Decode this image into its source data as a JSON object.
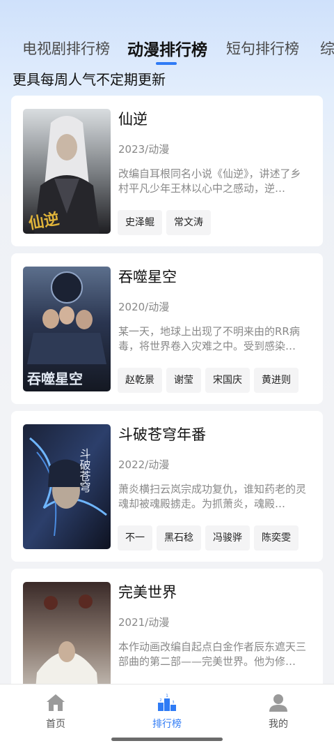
{
  "tabs": [
    {
      "label": "电视剧排行榜"
    },
    {
      "label": "动漫排行榜"
    },
    {
      "label": "短句排行榜"
    },
    {
      "label": "综"
    }
  ],
  "active_tab": "动漫排行榜",
  "subtitle": "更具每周人气不定期更新",
  "cards": [
    {
      "title": "仙逆",
      "meta": "2023/动漫",
      "desc": "改编自耳根同名小说《仙逆》，讲述了乡村平凡少年王林以心中之感动，逆…",
      "tags": [
        "史泽鲲",
        "常文涛"
      ],
      "poster_text": "仙逆"
    },
    {
      "title": "吞噬星空",
      "meta": "2020/动漫",
      "desc": "某一天，地球上出现了不明来由的RR病毒，将世界卷入灾难之中。受到感染…",
      "tags": [
        "赵乾景",
        "谢莹",
        "宋国庆",
        "黄进则"
      ],
      "poster_text": "吞噬星空"
    },
    {
      "title": "斗破苍穹年番",
      "meta": "2022/动漫",
      "desc": "萧炎横扫云岚宗成功复仇，谁知药老的灵魂却被魂殿掳走。为抓萧炎，魂殿…",
      "tags": [
        "不一",
        "黑石稔",
        "冯骏骅",
        "陈奕雯"
      ],
      "poster_text": "斗破苍穹"
    },
    {
      "title": "完美世界",
      "meta": "2021/动漫",
      "desc": "本作动画改编自起点白金作者辰东遮天三部曲的第二部——完美世界。他为修…",
      "tags": [],
      "poster_text": ""
    }
  ],
  "bottom_nav": [
    {
      "label": "首页",
      "icon": "home-icon"
    },
    {
      "label": "排行榜",
      "icon": "podium-icon"
    },
    {
      "label": "我的",
      "icon": "person-icon"
    }
  ],
  "colors": {
    "accent": "#2f7bf5",
    "nav_inactive": "#9a9a9a"
  }
}
